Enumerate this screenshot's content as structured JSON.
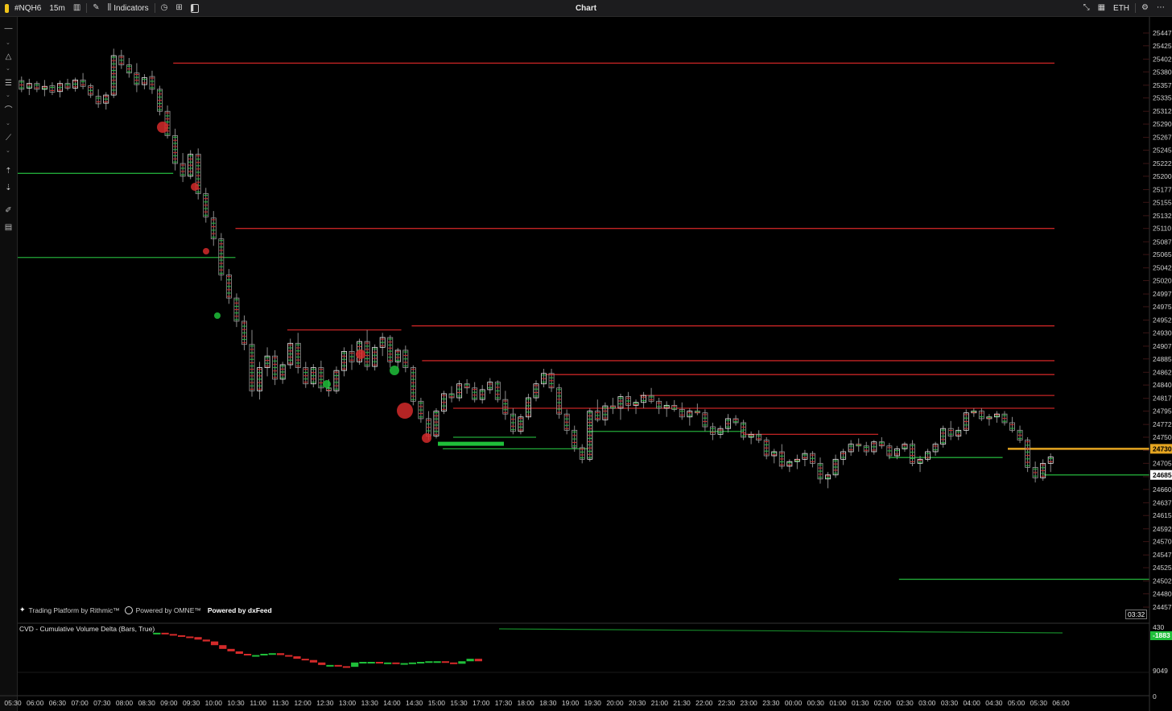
{
  "toolbar": {
    "symbol": "#NQH6",
    "timeframe": "15m",
    "indicators_label": "Indicators",
    "title": "Chart",
    "session_label": "ETH",
    "icons": [
      "candles-icon",
      "pencil-icon",
      "indicators-icon",
      "clock-icon",
      "layout-icon",
      "panel-icon",
      "collapse-icon",
      "calendar-icon",
      "gear-icon",
      "more-icon"
    ]
  },
  "sidebar": {
    "icons": [
      "crosshair-icon",
      "triangle-icon",
      "lines-icon",
      "curve-icon",
      "ruler-icon",
      "sort-up-icon",
      "sort-down-icon",
      "brush-icon",
      "list-icon"
    ]
  },
  "price_axis": {
    "ticks": [
      "25447",
      "25425",
      "25402",
      "25380",
      "25357",
      "25335",
      "25312",
      "25290",
      "25267",
      "25245",
      "25222",
      "25200",
      "25177",
      "25155",
      "25132",
      "25110",
      "25087",
      "25065",
      "25042",
      "25020",
      "24997",
      "24975",
      "24952",
      "24930",
      "24907",
      "24885",
      "24862",
      "24840",
      "24817",
      "24795",
      "24772",
      "24750",
      "24727",
      "24705",
      "24682",
      "24660",
      "24637",
      "24615",
      "24592",
      "24570",
      "24547",
      "24525",
      "24502",
      "24480",
      "24457"
    ],
    "current_price_label": "24730",
    "last_close_label": "24685"
  },
  "time_axis": {
    "ticks": [
      "05:30",
      "06:00",
      "06:30",
      "07:00",
      "07:30",
      "08:00",
      "08:30",
      "09:00",
      "09:30",
      "10:00",
      "10:30",
      "11:00",
      "11:30",
      "12:00",
      "12:30",
      "13:00",
      "13:30",
      "14:00",
      "14:30",
      "15:00",
      "15:30",
      "17:00",
      "17:30",
      "18:00",
      "18:30",
      "19:00",
      "19:30",
      "20:00",
      "20:30",
      "21:00",
      "21:30",
      "22:00",
      "22:30",
      "23:00",
      "23:30",
      "00:00",
      "00:30",
      "01:00",
      "01:30",
      "02:00",
      "02:30",
      "03:00",
      "03:30",
      "04:00",
      "04:30",
      "05:00",
      "05:30",
      "06:00"
    ]
  },
  "watermark": {
    "rithmic": "Trading Platform by Rithmic™",
    "omne": "Powered by OMNE™",
    "dxfeed": "Powered by dxFeed"
  },
  "cvd": {
    "label": "CVD - Cumulative Volume Delta (Bars, True)",
    "value_label": "-1883",
    "ticks": [
      "430",
      "9049",
      "0"
    ]
  },
  "bar_timer": "03:32",
  "colors": {
    "background": "#000000",
    "bull": "#1fbf3a",
    "bear": "#d42a2a",
    "level_red": "#c42424",
    "level_green": "#22a838",
    "current_price": "#e5a521"
  },
  "chart_data": {
    "type": "candlestick",
    "price_range": [
      24457,
      25447
    ],
    "candles": [
      [
        25365,
        25372,
        25345,
        25350
      ],
      [
        25352,
        25368,
        25340,
        25360
      ],
      [
        25360,
        25364,
        25345,
        25350
      ],
      [
        25350,
        25366,
        25338,
        25355
      ],
      [
        25356,
        25362,
        25340,
        25345
      ],
      [
        25346,
        25365,
        25336,
        25360
      ],
      [
        25360,
        25368,
        25348,
        25352
      ],
      [
        25352,
        25370,
        25346,
        25366
      ],
      [
        25366,
        25378,
        25350,
        25355
      ],
      [
        25356,
        25360,
        25335,
        25340
      ],
      [
        25338,
        25350,
        25318,
        25325
      ],
      [
        25326,
        25345,
        25315,
        25340
      ],
      [
        25340,
        25420,
        25335,
        25408
      ],
      [
        25408,
        25418,
        25385,
        25392
      ],
      [
        25392,
        25404,
        25370,
        25378
      ],
      [
        25378,
        25395,
        25345,
        25358
      ],
      [
        25358,
        25376,
        25350,
        25370
      ],
      [
        25372,
        25382,
        25342,
        25350
      ],
      [
        25350,
        25356,
        25305,
        25312
      ],
      [
        25312,
        25322,
        25265,
        25270
      ],
      [
        25270,
        25282,
        25210,
        25222
      ],
      [
        25222,
        25240,
        25190,
        25200
      ],
      [
        25200,
        25245,
        25195,
        25238
      ],
      [
        25238,
        25248,
        25160,
        25170
      ],
      [
        25170,
        25180,
        25120,
        25130
      ],
      [
        25128,
        25140,
        25080,
        25092
      ],
      [
        25092,
        25102,
        25020,
        25030
      ],
      [
        25030,
        25040,
        24980,
        24990
      ],
      [
        24990,
        24998,
        24940,
        24950
      ],
      [
        24950,
        24960,
        24900,
        24910
      ],
      [
        24910,
        24935,
        24820,
        24830
      ],
      [
        24830,
        24880,
        24815,
        24870
      ],
      [
        24870,
        24905,
        24855,
        24890
      ],
      [
        24890,
        24900,
        24840,
        24850
      ],
      [
        24850,
        24880,
        24842,
        24875
      ],
      [
        24875,
        24920,
        24868,
        24912
      ],
      [
        24912,
        24930,
        24860,
        24870
      ],
      [
        24870,
        24880,
        24835,
        24842
      ],
      [
        24842,
        24876,
        24836,
        24870
      ],
      [
        24870,
        24882,
        24828,
        24835
      ],
      [
        24835,
        24850,
        24820,
        24830
      ],
      [
        24830,
        24872,
        24825,
        24865
      ],
      [
        24865,
        24905,
        24855,
        24898
      ],
      [
        24898,
        24910,
        24866,
        24880
      ],
      [
        24880,
        24920,
        24875,
        24915
      ],
      [
        24915,
        24935,
        24865,
        24872
      ],
      [
        24872,
        24910,
        24865,
        24905
      ],
      [
        24905,
        24930,
        24890,
        24922
      ],
      [
        24922,
        24926,
        24870,
        24880
      ],
      [
        24880,
        24904,
        24868,
        24900
      ],
      [
        24900,
        24908,
        24862,
        24870
      ],
      [
        24870,
        24874,
        24805,
        24812
      ],
      [
        24812,
        24818,
        24775,
        24782
      ],
      [
        24782,
        24795,
        24745,
        24752
      ],
      [
        24752,
        24800,
        24748,
        24795
      ],
      [
        24795,
        24830,
        24790,
        24825
      ],
      [
        24825,
        24838,
        24810,
        24818
      ],
      [
        24818,
        24848,
        24812,
        24842
      ],
      [
        24842,
        24850,
        24825,
        24835
      ],
      [
        24835,
        24845,
        24810,
        24815
      ],
      [
        24815,
        24840,
        24808,
        24832
      ],
      [
        24832,
        24852,
        24825,
        24845
      ],
      [
        24845,
        24848,
        24810,
        24815
      ],
      [
        24815,
        24830,
        24780,
        24790
      ],
      [
        24790,
        24800,
        24755,
        24760
      ],
      [
        24760,
        24790,
        24755,
        24785
      ],
      [
        24785,
        24825,
        24780,
        24818
      ],
      [
        24818,
        24848,
        24812,
        24842
      ],
      [
        24842,
        24868,
        24836,
        24860
      ],
      [
        24860,
        24868,
        24828,
        24835
      ],
      [
        24835,
        24842,
        24782,
        24790
      ],
      [
        24790,
        24798,
        24755,
        24762
      ],
      [
        24762,
        24770,
        24725,
        24732
      ],
      [
        24732,
        24738,
        24705,
        24712
      ],
      [
        24712,
        24800,
        24708,
        24795
      ],
      [
        24795,
        24815,
        24776,
        24780
      ],
      [
        24780,
        24810,
        24770,
        24804
      ],
      [
        24804,
        24818,
        24790,
        24800
      ],
      [
        24800,
        24825,
        24780,
        24820
      ],
      [
        24820,
        24828,
        24795,
        24805
      ],
      [
        24805,
        24815,
        24790,
        24810
      ],
      [
        24810,
        24828,
        24800,
        24822
      ],
      [
        24822,
        24835,
        24808,
        24812
      ],
      [
        24812,
        24818,
        24790,
        24800
      ],
      [
        24800,
        24812,
        24785,
        24805
      ],
      [
        24805,
        24814,
        24794,
        24798
      ],
      [
        24798,
        24810,
        24780,
        24785
      ],
      [
        24785,
        24800,
        24770,
        24795
      ],
      [
        24795,
        24808,
        24788,
        24792
      ],
      [
        24792,
        24798,
        24760,
        24768
      ],
      [
        24768,
        24775,
        24745,
        24755
      ],
      [
        24755,
        24770,
        24748,
        24765
      ],
      [
        24765,
        24790,
        24758,
        24782
      ],
      [
        24782,
        24788,
        24770,
        24775
      ],
      [
        24775,
        24780,
        24745,
        24750
      ],
      [
        24750,
        24760,
        24738,
        24755
      ],
      [
        24755,
        24762,
        24740,
        24745
      ],
      [
        24745,
        24750,
        24712,
        24718
      ],
      [
        24718,
        24730,
        24705,
        24725
      ],
      [
        24725,
        24738,
        24695,
        24700
      ],
      [
        24700,
        24712,
        24690,
        24708
      ],
      [
        24708,
        24720,
        24695,
        24712
      ],
      [
        24712,
        24728,
        24700,
        24722
      ],
      [
        24722,
        24726,
        24698,
        24705
      ],
      [
        24705,
        24715,
        24670,
        24678
      ],
      [
        24678,
        24690,
        24662,
        24685
      ],
      [
        24685,
        24720,
        24680,
        24712
      ],
      [
        24712,
        24730,
        24702,
        24725
      ],
      [
        24725,
        24745,
        24718,
        24738
      ],
      [
        24738,
        24748,
        24725,
        24735
      ],
      [
        24735,
        24742,
        24718,
        24725
      ],
      [
        24725,
        24745,
        24720,
        24742
      ],
      [
        24742,
        24750,
        24730,
        24735
      ],
      [
        24735,
        24740,
        24712,
        24718
      ],
      [
        24718,
        24735,
        24712,
        24730
      ],
      [
        24730,
        24742,
        24725,
        24738
      ],
      [
        24738,
        24745,
        24700,
        24705
      ],
      [
        24705,
        24718,
        24690,
        24712
      ],
      [
        24712,
        24730,
        24708,
        24725
      ],
      [
        24725,
        24742,
        24718,
        24738
      ],
      [
        24738,
        24770,
        24732,
        24765
      ],
      [
        24765,
        24778,
        24745,
        24752
      ],
      [
        24752,
        24768,
        24745,
        24762
      ],
      [
        24762,
        24798,
        24755,
        24792
      ],
      [
        24792,
        24800,
        24785,
        24795
      ],
      [
        24795,
        24800,
        24778,
        24782
      ],
      [
        24782,
        24790,
        24770,
        24785
      ],
      [
        24785,
        24795,
        24775,
        24790
      ],
      [
        24790,
        24795,
        24770,
        24775
      ],
      [
        24775,
        24785,
        24758,
        24762
      ],
      [
        24762,
        24770,
        24740,
        24745
      ],
      [
        24745,
        24750,
        24690,
        24698
      ],
      [
        24698,
        24708,
        24672,
        24680
      ],
      [
        24680,
        24712,
        24675,
        24705
      ],
      [
        24705,
        24722,
        24690,
        24716
      ]
    ],
    "levels": [
      {
        "price": 25395,
        "color": "red",
        "from": 0.15,
        "to": 1
      },
      {
        "price": 25205,
        "color": "green",
        "from": 0,
        "to": 0.15
      },
      {
        "price": 25110,
        "color": "red",
        "from": 0.21,
        "to": 1
      },
      {
        "price": 25060,
        "color": "green",
        "from": 0,
        "to": 0.21
      },
      {
        "price": 24935,
        "color": "red",
        "from": 0.26,
        "to": 0.37
      },
      {
        "price": 24942,
        "color": "red",
        "from": 0.38,
        "to": 1
      },
      {
        "price": 24882,
        "color": "red",
        "from": 0.39,
        "to": 1
      },
      {
        "price": 24858,
        "color": "red",
        "from": 0.51,
        "to": 1
      },
      {
        "price": 24822,
        "color": "red",
        "from": 0.6,
        "to": 1
      },
      {
        "price": 24800,
        "color": "red",
        "from": 0.42,
        "to": 1
      },
      {
        "price": 24750,
        "color": "green",
        "from": 0.42,
        "to": 0.5
      },
      {
        "price": 24730,
        "color": "green",
        "from": 0.41,
        "to": 0.55
      },
      {
        "price": 24760,
        "color": "green",
        "from": 0.55,
        "to": 0.7
      },
      {
        "price": 24755,
        "color": "red",
        "from": 0.7,
        "to": 0.83
      },
      {
        "price": 24715,
        "color": "green",
        "from": 0.84,
        "to": 0.95
      },
      {
        "price": 24685,
        "color": "green",
        "from": 0.99,
        "to": 1.1
      },
      {
        "price": 24505,
        "color": "green",
        "from": 0.85,
        "to": 1.1
      }
    ],
    "current_price": 24730,
    "cvd_values": [
      1900,
      1900,
      1880,
      1860,
      1840,
      1830,
      1790,
      1760,
      1700,
      1640,
      1600,
      1560,
      1540,
      1540,
      1560,
      1570,
      1540,
      1520,
      1480,
      1460,
      1420,
      1380,
      1380,
      1360,
      1350,
      1420,
      1430,
      1430,
      1420,
      1420,
      1410,
      1410,
      1420,
      1430,
      1440,
      1440,
      1420,
      1400,
      1440,
      1480,
      1440
    ]
  }
}
